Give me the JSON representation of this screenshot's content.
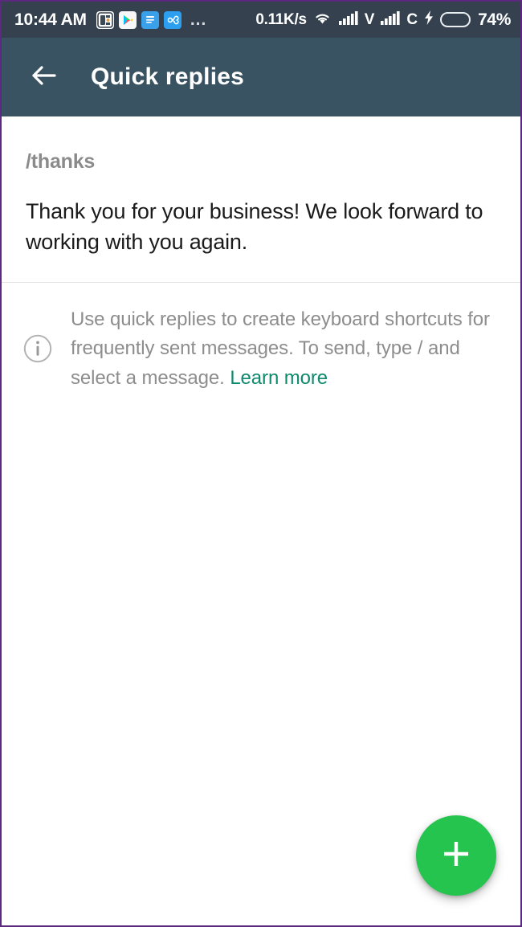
{
  "status_bar": {
    "clock": "10:44 AM",
    "overflow_label": "...",
    "network_speed": "0.11K/s",
    "sim1_label": "V",
    "sim2_label": "C",
    "battery_percent": "74%",
    "battery_level": 74,
    "battery_color": "#3fc628",
    "background": "#35414f",
    "app_icons": [
      {
        "name": "app-icon-white-square"
      },
      {
        "name": "app-icon-play-store"
      },
      {
        "name": "app-icon-document"
      },
      {
        "name": "app-icon-infinity"
      }
    ],
    "icons": {
      "wifi": "wifi-icon",
      "signal1": "signal-bars-icon",
      "signal2": "signal-bars-icon",
      "charging": "lightning-bolt-icon",
      "battery": "battery-icon"
    }
  },
  "app_bar": {
    "title": "Quick replies",
    "back_icon": "back-arrow-icon",
    "background": "#3a5362",
    "text_color": "#ffffff"
  },
  "reply_item": {
    "shortcut": "/thanks",
    "message": "Thank you for your business! We look forward to working with you again.",
    "shortcut_color": "#8b8b8b",
    "message_color": "#1b1b1b"
  },
  "info": {
    "icon": "info-circle-icon",
    "text": "Use quick replies to create keyboard shortcuts for frequently sent messages. To send, type / and select a message. ",
    "link_label": "Learn more",
    "text_color": "#8d8d8d",
    "link_color": "#0f8a6d"
  },
  "fab": {
    "icon": "plus-icon",
    "label": "Add quick reply",
    "color": "#25c44e"
  }
}
